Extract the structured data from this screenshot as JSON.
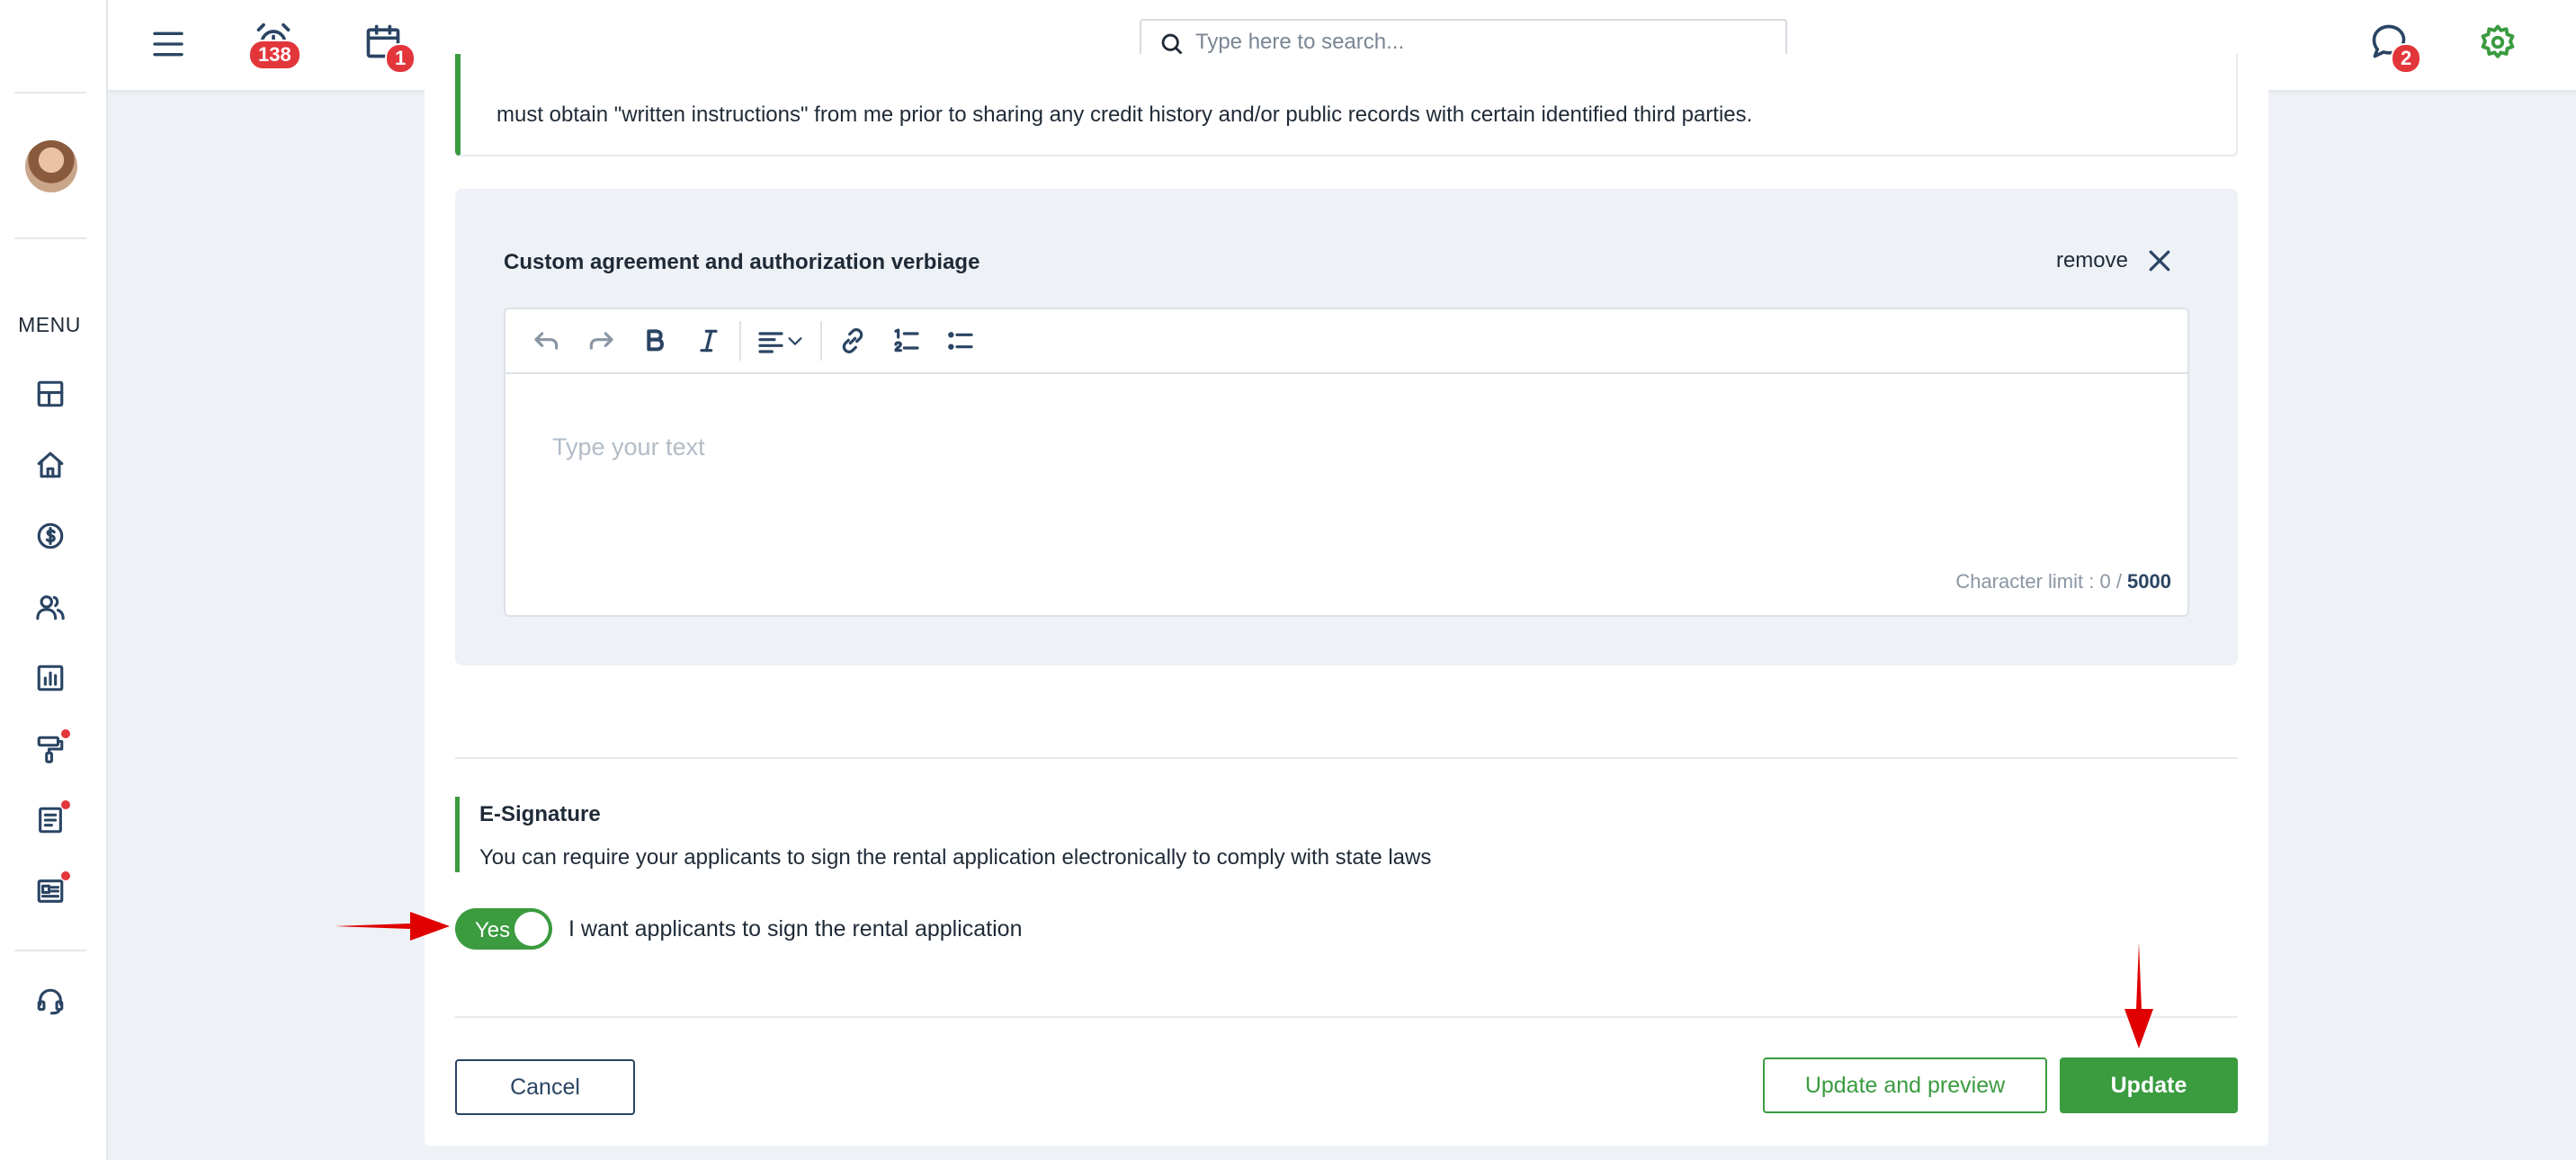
{
  "topbar": {
    "alarm_badge": "138",
    "calendar_badge": "1",
    "chat_badge": "2",
    "search_placeholder": "Type here to search..."
  },
  "sidebar": {
    "menu_label": "MENU",
    "items": [
      {
        "icon": "dashboard-icon",
        "dot": false
      },
      {
        "icon": "home-icon",
        "dot": false
      },
      {
        "icon": "dollar-icon",
        "dot": false
      },
      {
        "icon": "users-icon",
        "dot": false
      },
      {
        "icon": "reports-icon",
        "dot": false
      },
      {
        "icon": "paint-roller-icon",
        "dot": true
      },
      {
        "icon": "document-icon",
        "dot": true
      },
      {
        "icon": "listing-icon",
        "dot": true
      },
      {
        "icon": "support-icon",
        "dot": false
      }
    ]
  },
  "previous_block": {
    "text": "must obtain \"written instructions\" from me prior to sharing any credit history and/or public records with certain identified third parties."
  },
  "custom_agreement": {
    "title": "Custom agreement and authorization verbiage",
    "remove_label": "remove",
    "editor_placeholder": "Type your text",
    "char_limit_label": "Character limit : 0 / ",
    "char_limit_max": "5000"
  },
  "esignature": {
    "title": "E-Signature",
    "description": "You can require your applicants to sign the rental application electronically to comply with state laws",
    "toggle_label": "Yes",
    "toggle_on": true,
    "toggle_text": "I want applicants to sign the rental application"
  },
  "buttons": {
    "cancel": "Cancel",
    "update_preview": "Update and preview",
    "update": "Update"
  },
  "colors": {
    "accent": "#3a9b3f",
    "badge": "#e2363a",
    "arrow": "#e00000"
  }
}
